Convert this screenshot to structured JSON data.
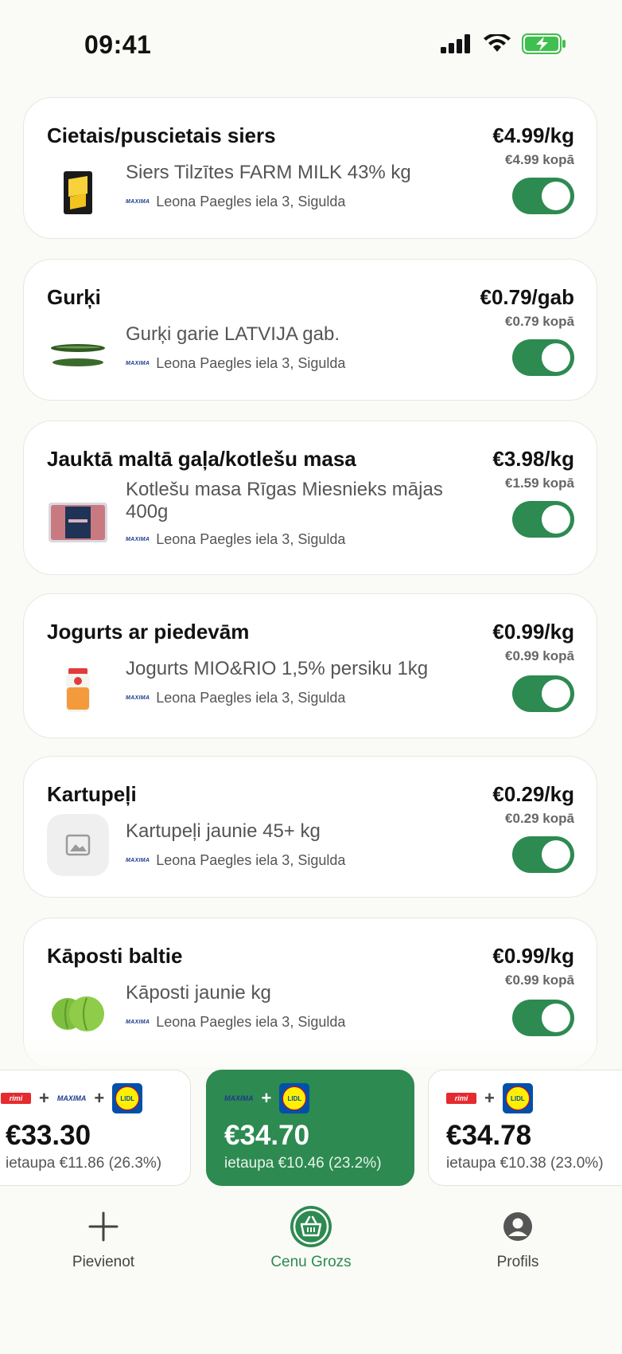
{
  "status_bar": {
    "time": "09:41"
  },
  "colors": {
    "accent": "#2d8a51",
    "card_bg": "#ffffff",
    "page_bg": "#fafaf6"
  },
  "items": [
    {
      "title": "Cietais/puscietais siers",
      "price": "€4.99/kg",
      "total": "€4.99 kopā",
      "product": "Siers Tilzītes FARM MILK 43% kg",
      "store": "Leona Paegles iela 3, Sigulda",
      "store_logo": "MAXIMA",
      "thumb": "cheese-icon",
      "enabled": true
    },
    {
      "title": "Gurķi",
      "price": "€0.79/gab",
      "total": "€0.79 kopā",
      "product": "Gurķi garie LATVIJA gab.",
      "store": "Leona Paegles iela 3, Sigulda",
      "store_logo": "MAXIMA",
      "thumb": "cucumber-icon",
      "enabled": true
    },
    {
      "title": "Jauktā maltā gaļa/kotlešu masa",
      "price": "€3.98/kg",
      "total": "€1.59 kopā",
      "product": "Kotlešu masa Rīgas Miesnieks mājas 400g",
      "store": "Leona Paegles iela 3, Sigulda",
      "store_logo": "MAXIMA",
      "thumb": "minced-meat-icon",
      "enabled": true
    },
    {
      "title": "Jogurts ar piedevām",
      "price": "€0.99/kg",
      "total": "€0.99 kopā",
      "product": "Jogurts MIO&RIO 1,5% persiku 1kg",
      "store": "Leona Paegles iela 3, Sigulda",
      "store_logo": "MAXIMA",
      "thumb": "yogurt-icon",
      "enabled": true
    },
    {
      "title": "Kartupeļi",
      "price": "€0.29/kg",
      "total": "€0.29 kopā",
      "product": "Kartupeļi jaunie 45+ kg",
      "store": "Leona Paegles iela 3, Sigulda",
      "store_logo": "MAXIMA",
      "thumb": "image-placeholder-icon",
      "enabled": true
    },
    {
      "title": "Kāposti baltie",
      "price": "€0.99/kg",
      "total": "€0.99 kopā",
      "product": "Kāposti jaunie kg",
      "store": "Leona Paegles iela 3, Sigulda",
      "store_logo": "MAXIMA",
      "thumb": "cabbage-icon",
      "enabled": true
    }
  ],
  "combos": [
    {
      "stores": [
        "rimi",
        "MAXIMA",
        "LIDL"
      ],
      "total": "€33.30",
      "savings": "ietaupa €11.86 (26.3%)",
      "selected": false
    },
    {
      "stores": [
        "MAXIMA",
        "LIDL"
      ],
      "total": "€34.70",
      "savings": "ietaupa €10.46 (23.2%)",
      "selected": true
    },
    {
      "stores": [
        "rimi",
        "LIDL"
      ],
      "total": "€34.78",
      "savings": "ietaupa €10.38 (23.0%)",
      "selected": false
    }
  ],
  "logo_text": {
    "rimi": "rimi",
    "maxima": "MAXIMA",
    "lidl": "LIDL"
  },
  "tabs": [
    {
      "label": "Pievienot",
      "icon": "plus-icon",
      "active": false
    },
    {
      "label": "Cenu Grozs",
      "icon": "basket-icon",
      "active": true
    },
    {
      "label": "Profils",
      "icon": "profile-icon",
      "active": false
    }
  ]
}
